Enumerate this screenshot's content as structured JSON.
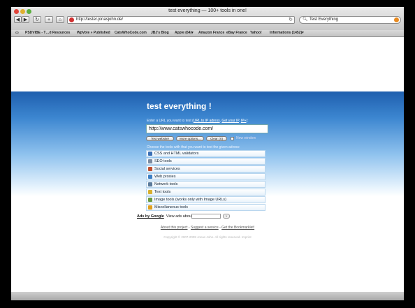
{
  "window": {
    "title": "test everything — 100+ tools in one!"
  },
  "toolbar": {
    "back_icon": "back-arrow-icon",
    "forward_icon": "forward-arrow-icon",
    "reload_icon": "reload-icon",
    "add_bookmark_icon": "plus-icon",
    "home_icon": "home-icon",
    "url": "http://tester.jonasjohn.de/",
    "search_value": "Test Everything"
  },
  "bookmarks": [
    "PSDVIBE - T…d Resources",
    "WpVote » Published",
    "CatsWhoCode.com",
    "JBJ's Blog",
    "Apple (64)▾",
    "Amazon France",
    "eBay France",
    "Yahoo!",
    "Informations (1452)▾"
  ],
  "page": {
    "title": "test everything !",
    "prompt_text": "Enter a URL you want to test (",
    "prompt_links": [
      "URL to IP adress",
      "Get your IP",
      "IP+"
    ],
    "url_value": "http://www.catswhocode.com/",
    "buttons": [
      "Test website!",
      "More options...",
      "Clear (X)"
    ],
    "new_window_label": "New window",
    "choose_label": "Choose the tools with that you want to test the given adress:",
    "tools": [
      {
        "label": "CSS and HTML validators",
        "color": "#3a6fb5"
      },
      {
        "label": "SEO tools",
        "color": "#7a8aa0"
      },
      {
        "label": "Social services",
        "color": "#c05030"
      },
      {
        "label": "Web proxies",
        "color": "#3d7fc4"
      },
      {
        "label": "Network tools",
        "color": "#5a7a9a"
      },
      {
        "label": "Text tools",
        "color": "#d8b030"
      },
      {
        "label": "Image tools (works only with Image URLs)",
        "color": "#6a9a40"
      },
      {
        "label": "Miscellaneous tools",
        "color": "#e0a020"
      }
    ],
    "ads_label": "Ads by Google",
    "ads_view": "View ads about:",
    "footer_links": [
      "About this project",
      "Suggest a service",
      "Get the Bookmarklet!"
    ],
    "copyright": "Copyright © 2007-2009 Jonas John. All rights reserved. Imprint"
  }
}
